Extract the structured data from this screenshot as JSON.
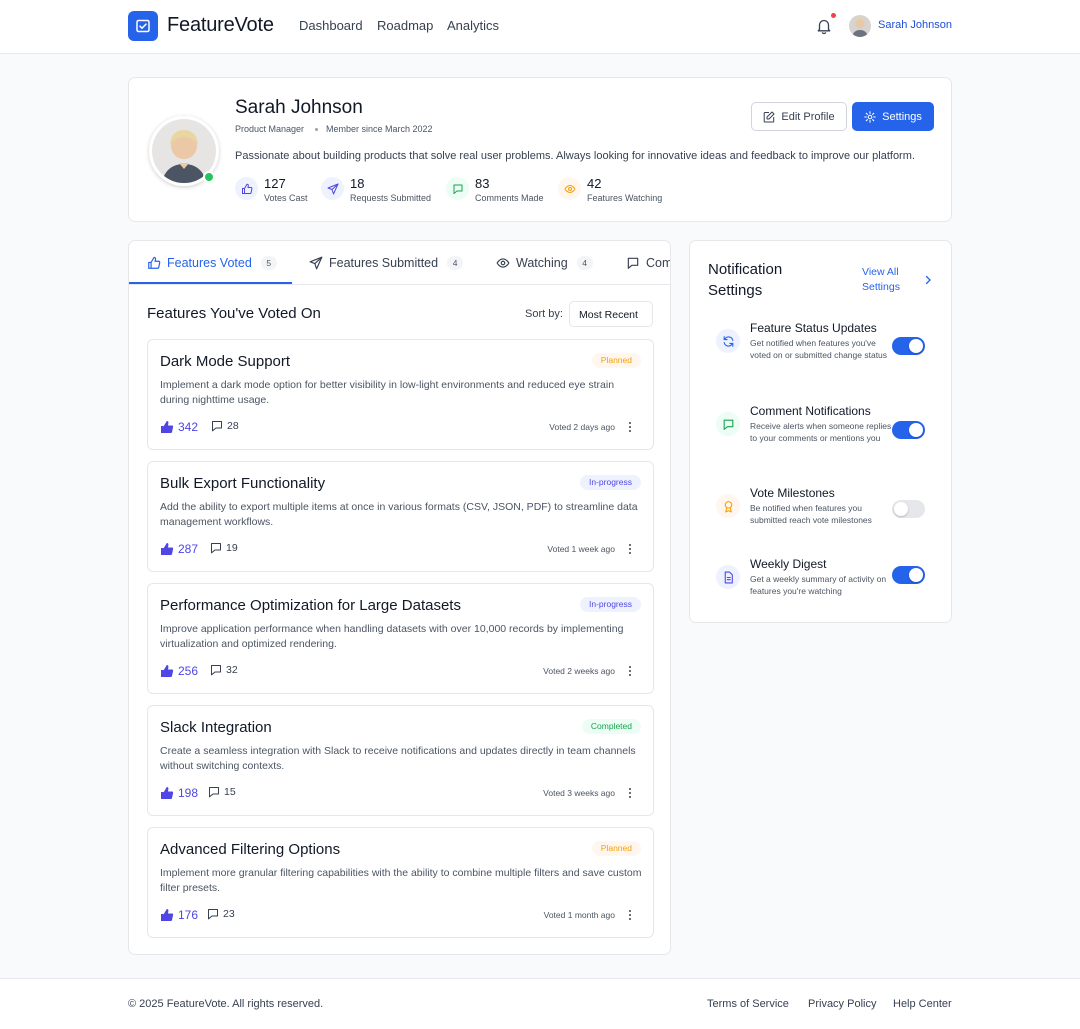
{
  "brand": {
    "name": "FeatureVote"
  },
  "nav": {
    "links": [
      "Dashboard",
      "Roadmap",
      "Analytics"
    ],
    "user_name": "Sarah Johnson"
  },
  "profile": {
    "name": "Sarah Johnson",
    "role": "Product Manager",
    "member_since": "Member since March 2022",
    "bio": "Passionate about building products that solve real user problems. Always looking for innovative ideas and feedback to improve our platform.",
    "edit_label": "Edit Profile",
    "settings_label": "Settings",
    "stats": [
      {
        "value": "127",
        "label": "Votes Cast",
        "icon": "thumbs-up-icon"
      },
      {
        "value": "18",
        "label": "Requests Submitted",
        "icon": "send-icon"
      },
      {
        "value": "83",
        "label": "Comments Made",
        "icon": "comment-icon"
      },
      {
        "value": "42",
        "label": "Features Watching",
        "icon": "eye-icon"
      }
    ]
  },
  "tabs": [
    {
      "label": "Features Voted",
      "count": "5",
      "active": true
    },
    {
      "label": "Features Submitted",
      "count": "4"
    },
    {
      "label": "Watching",
      "count": "4"
    },
    {
      "label": "Comments",
      "count": ""
    }
  ],
  "features_section": {
    "title": "Features You've Voted On",
    "sort_label": "Sort by:",
    "sort_value": "Most Recent"
  },
  "features": [
    {
      "title": "Dark Mode Support",
      "status": "Planned",
      "status_color": "#f59e0b",
      "description": "Implement a dark mode option for better visibility in low-light environments and reduced eye strain during nighttime usage.",
      "votes": "342",
      "comments": "28",
      "voted": "Voted 2 days ago"
    },
    {
      "title": "Bulk Export Functionality",
      "status": "In-progress",
      "status_color": "#4f46e5",
      "description": "Add the ability to export multiple items at once in various formats (CSV, JSON, PDF) to streamline data management workflows.",
      "votes": "287",
      "comments": "19",
      "voted": "Voted 1 week ago"
    },
    {
      "title": "Performance Optimization for Large Datasets",
      "status": "In-progress",
      "status_color": "#4f46e5",
      "description": "Improve application performance when handling datasets with over 10,000 records by implementing virtualization and optimized rendering.",
      "votes": "256",
      "comments": "32",
      "voted": "Voted 2 weeks ago"
    },
    {
      "title": "Slack Integration",
      "status": "Completed",
      "status_color": "#16a34a",
      "description": "Create a seamless integration with Slack to receive notifications and updates directly in team channels without switching contexts.",
      "votes": "198",
      "comments": "15",
      "voted": "Voted 3 weeks ago"
    },
    {
      "title": "Advanced Filtering Options",
      "status": "Planned",
      "status_color": "#f59e0b",
      "description": "Implement more granular filtering capabilities with the ability to combine multiple filters and save custom filter presets.",
      "votes": "176",
      "comments": "23",
      "voted": "Voted 1 month ago"
    }
  ],
  "notifications": {
    "title": "Notification Settings",
    "view_all": "View All Settings",
    "items": [
      {
        "title": "Feature Status Updates",
        "description": "Get notified when features you've voted on or submitted change status",
        "enabled": true,
        "icon": "refresh-icon"
      },
      {
        "title": "Comment Notifications",
        "description": "Receive alerts when someone replies to your comments or mentions you",
        "enabled": true,
        "icon": "comment-icon"
      },
      {
        "title": "Vote Milestones",
        "description": "Be notified when features you submitted reach vote milestones",
        "enabled": false,
        "icon": "award-icon"
      },
      {
        "title": "Weekly Digest",
        "description": "Get a weekly summary of activity on features you're watching",
        "enabled": true,
        "icon": "document-icon"
      }
    ]
  },
  "colors": {
    "accent": "#2563eb",
    "vote": "#4f46e5",
    "online": "#22c55e"
  },
  "footer": {
    "copyright": "© 2025 FeatureVote. All rights reserved.",
    "links": [
      "Terms of Service",
      "Privacy Policy",
      "Help Center"
    ]
  }
}
